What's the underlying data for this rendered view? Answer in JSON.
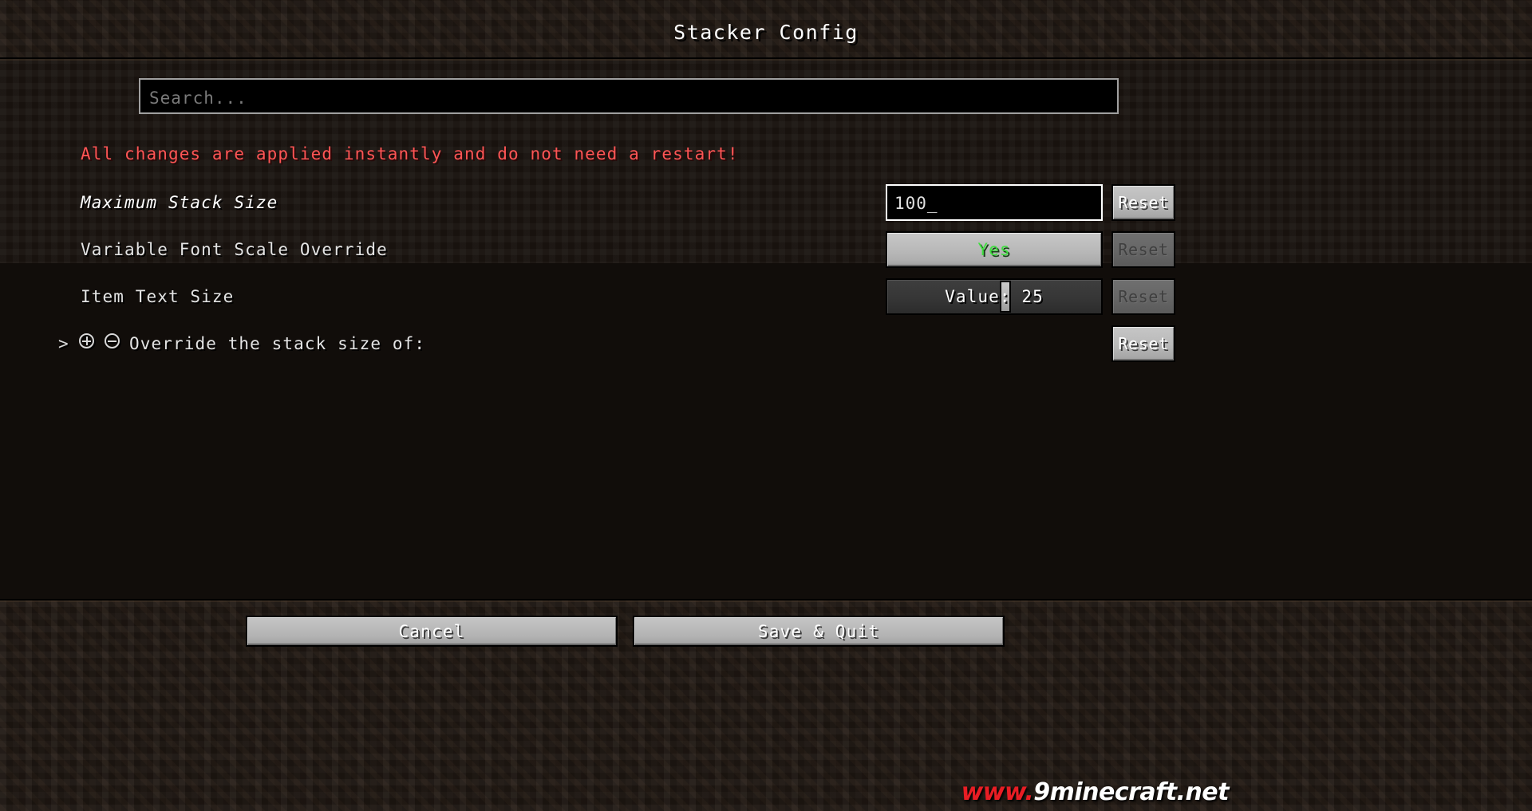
{
  "window": {
    "title": "Stacker Config"
  },
  "search": {
    "placeholder": "Search...",
    "value": ""
  },
  "warning": {
    "text": "All changes are applied instantly and do not need a restart!",
    "color": "#ff5555"
  },
  "rows": [
    {
      "label": "Maximum Stack Size",
      "modified": true,
      "widget": "text-input",
      "value": "100_",
      "reset_label": "Reset",
      "reset_enabled": true
    },
    {
      "label": "Variable Font Scale Override",
      "modified": false,
      "widget": "toggle",
      "value": "Yes",
      "value_color": "#3ee03e",
      "reset_label": "Reset",
      "reset_enabled": false
    },
    {
      "label": "Item Text Size",
      "modified": false,
      "widget": "slider",
      "value": "Value: 25",
      "slider_number": 25,
      "reset_label": "Reset",
      "reset_enabled": false
    }
  ],
  "category": {
    "chevron": ">",
    "expand_icon": "plus-circle-icon",
    "collapse_icon": "minus-circle-icon",
    "label": "Override the stack size of:",
    "reset_label": "Reset",
    "reset_enabled": true,
    "expanded": false
  },
  "footer": {
    "cancel_label": "Cancel",
    "save_label": "Save & Quit"
  },
  "watermark": {
    "prefix": "www.",
    "suffix": "9minecraft.net"
  }
}
